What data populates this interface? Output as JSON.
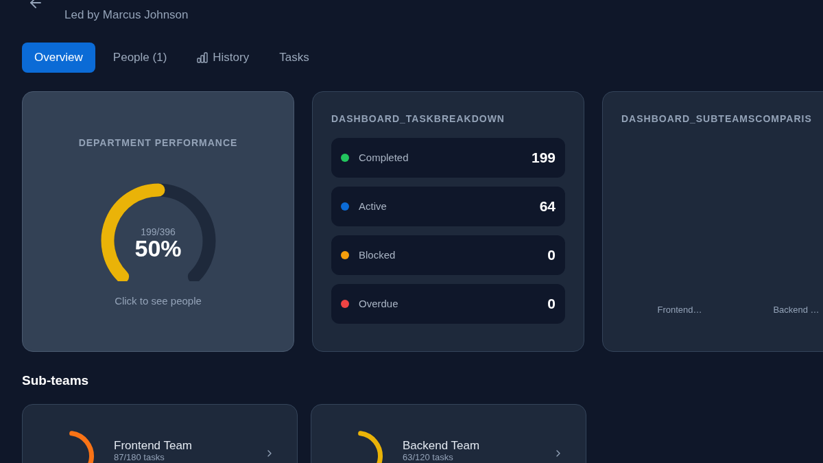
{
  "header": {
    "subtitle": "Led by Marcus Johnson"
  },
  "tabs": [
    {
      "label": "Overview",
      "selected": true,
      "has_icon": false
    },
    {
      "label": "People (1)",
      "selected": false,
      "has_icon": false
    },
    {
      "label": "History",
      "selected": false,
      "has_icon": true
    },
    {
      "label": "Tasks",
      "selected": false,
      "has_icon": false
    }
  ],
  "performance_card": {
    "title": "DEPARTMENT PERFORMANCE",
    "ratio": "199/396",
    "percent": "50%",
    "level": 0.5,
    "hint": "Click to see people"
  },
  "task_breakdown": {
    "title": "DASHBOARD_TASKBREAKDOWN",
    "items": [
      {
        "label": "Completed",
        "value": "199",
        "color": "#22c55e"
      },
      {
        "label": "Active",
        "value": "64",
        "color": "#0b6bd6"
      },
      {
        "label": "Blocked",
        "value": "0",
        "color": "#f59e0b"
      },
      {
        "label": "Overdue",
        "value": "0",
        "color": "#ef4444"
      }
    ]
  },
  "subteams_comparison": {
    "title": "DASHBOARD_SUBTEAMSCOMPARIS",
    "axis_labels": [
      "Frontend…",
      "Backend …"
    ]
  },
  "subteams": {
    "heading": "Sub-teams",
    "items": [
      {
        "name": "Frontend Team",
        "tasks": "87/180 tasks",
        "color": "#f97316"
      },
      {
        "name": "Backend Team",
        "tasks": "63/120 tasks",
        "color": "#eab308"
      }
    ]
  }
}
